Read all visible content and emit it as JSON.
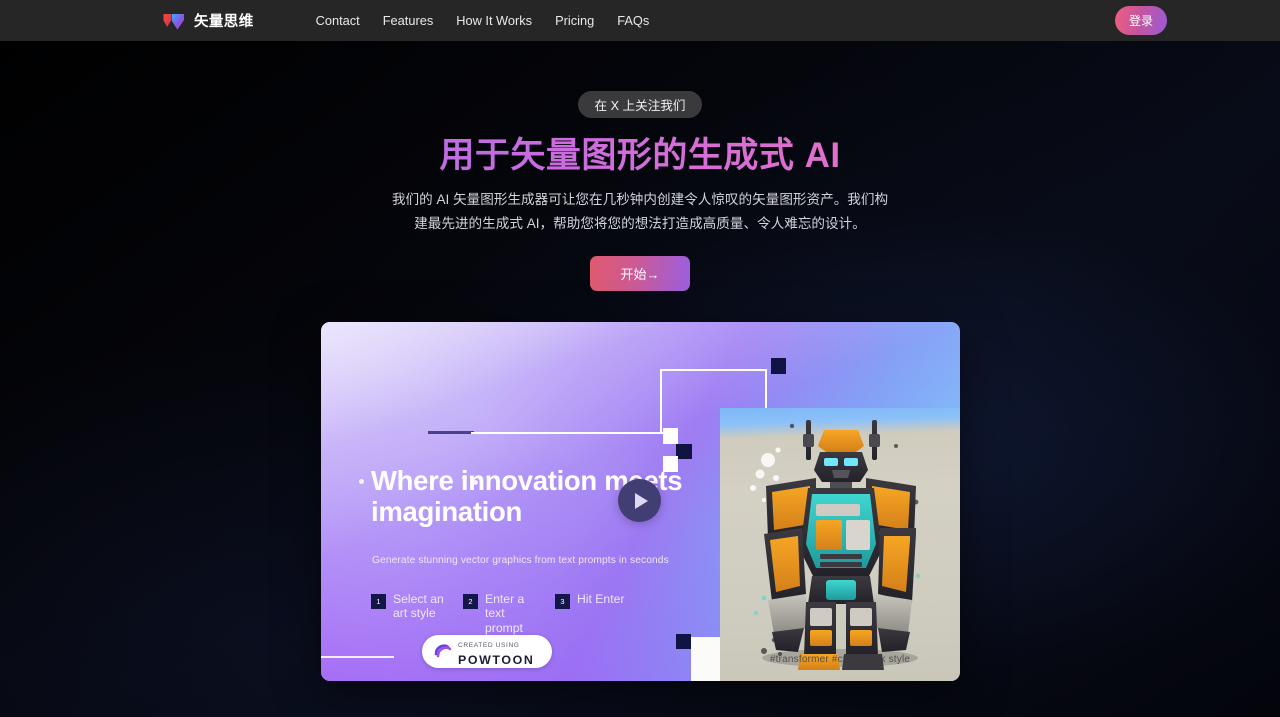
{
  "navbar": {
    "brand_name": "矢量思维",
    "brand_icon": "v-logo-icon",
    "links": [
      {
        "label": "Contact"
      },
      {
        "label": "Features"
      },
      {
        "label": "How It Works"
      },
      {
        "label": "Pricing"
      },
      {
        "label": "FAQs"
      }
    ],
    "login_label": "登录",
    "background_color": "#262626",
    "login_gradient": [
      "#ef5d7e",
      "#9b5ad6"
    ]
  },
  "hero": {
    "badge_label": "在 X 上关注我们",
    "title": "用于矢量图形的生成式 AI",
    "subtitle": "我们的 AI 矢量图形生成器可让您在几秒钟内创建令人惊叹的矢量图形资产。我们构建最先进的生成式 AI，帮助您将您的想法打造成高质量、令人难忘的设计。",
    "cta_label": "开始→",
    "title_gradient": [
      "#9a6bf0",
      "#f07ab6"
    ],
    "cta_gradient": [
      "#e05a6e",
      "#9b5fe0"
    ]
  },
  "media_card": {
    "heading": "Where innovation meets imagination",
    "subtitle": "Generate stunning vector graphics from text prompts in seconds",
    "play_icon": "play-icon",
    "steps": [
      {
        "number": "1",
        "label": "Select an art style"
      },
      {
        "number": "2",
        "label": "Enter a text prompt"
      },
      {
        "number": "3",
        "label": "Hit Enter"
      }
    ],
    "image_caption": "#transformer #cyberpunk style",
    "watermark": {
      "top_label": "CREATED USING",
      "main_label": "POWTOON",
      "icon": "powtoon-logo-icon"
    },
    "card_gradient": [
      "#e9e2fb",
      "#9d7cf2",
      "#8ec4fb"
    ],
    "accent_navy": "#101445"
  }
}
